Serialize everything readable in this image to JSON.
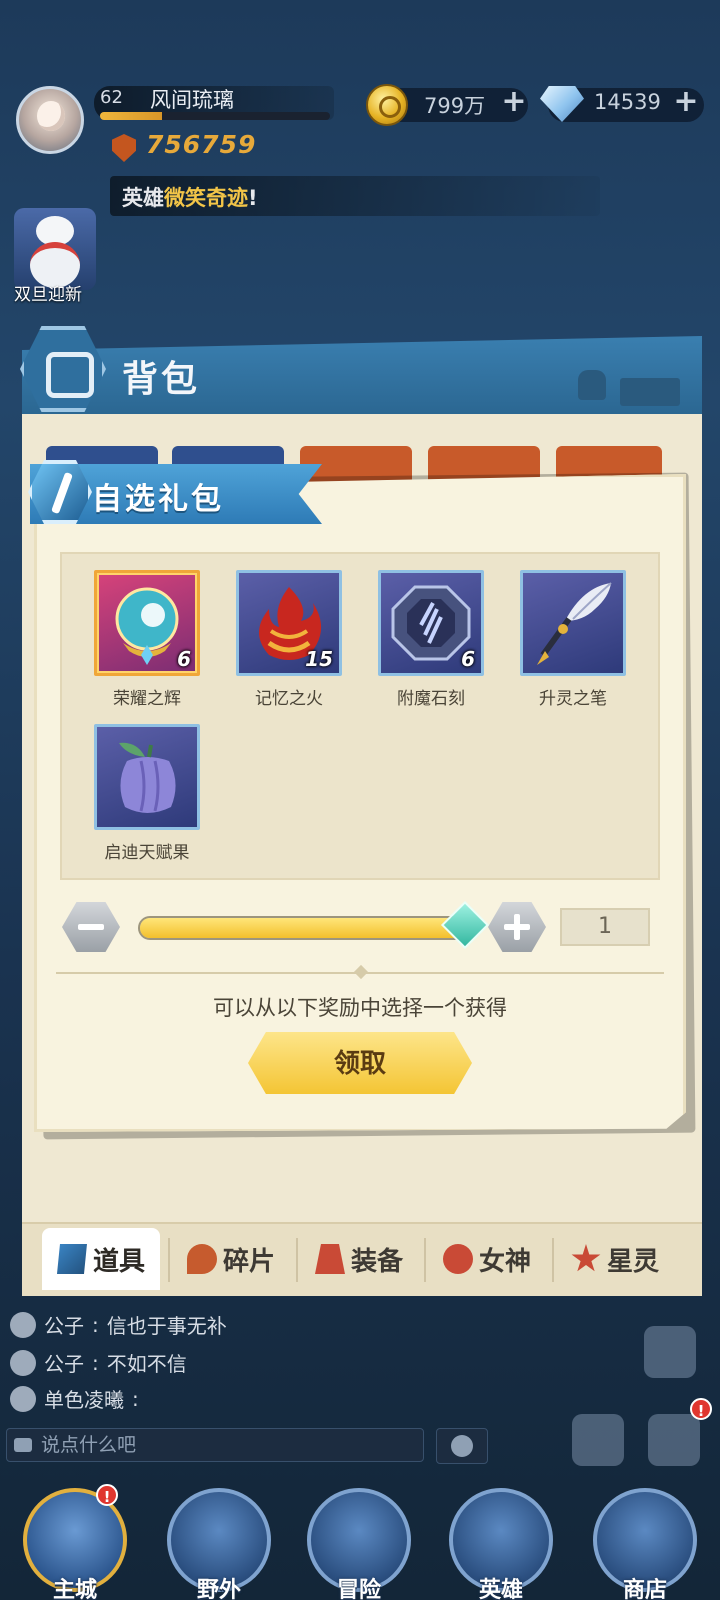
{
  "player": {
    "level": "62",
    "name": "风间琉璃",
    "exp_fraction": 0.27,
    "power": "756759"
  },
  "resources": {
    "gold": "799万",
    "diamonds": "14539"
  },
  "marquee": {
    "prefix": "英雄",
    "highlight": "微笑奇迹",
    "suffix": "!"
  },
  "event": {
    "label": "双旦迎新"
  },
  "backpack": {
    "title": "背包",
    "tabs": [
      {
        "label": "道具",
        "icon": "item-icon",
        "active": true
      },
      {
        "label": "碎片",
        "icon": "fragment-icon",
        "active": false
      },
      {
        "label": "装备",
        "icon": "equipment-icon",
        "active": false
      },
      {
        "label": "女神",
        "icon": "goddess-icon",
        "active": false
      },
      {
        "label": "星灵",
        "icon": "star-spirit-icon",
        "active": false
      }
    ]
  },
  "dialog": {
    "title": "自选礼包",
    "rewards": [
      {
        "name": "荣耀之辉",
        "count": "6",
        "icon": "glory-orb-icon",
        "rarity": "gold"
      },
      {
        "name": "记忆之火",
        "count": "15",
        "icon": "memory-fire-icon",
        "rarity": "blue"
      },
      {
        "name": "附魔石刻",
        "count": "6",
        "icon": "enchant-stone-icon",
        "rarity": "blue"
      },
      {
        "name": "升灵之笔",
        "count": "",
        "icon": "spirit-quill-icon",
        "rarity": "blue"
      },
      {
        "name": "启迪天赋果",
        "count": "",
        "icon": "talent-fruit-icon",
        "rarity": "blue"
      }
    ],
    "quantity": "1",
    "slider_fraction": 1.0,
    "hint": "可以从以下奖励中选择一个获得",
    "claim_label": "领取"
  },
  "chat": {
    "messages": [
      {
        "sender": "公子",
        "text": "信也于事无补"
      },
      {
        "sender": "公子",
        "text": "不如不信"
      },
      {
        "sender": "单色凌曦",
        "text": ""
      }
    ],
    "input_placeholder": "说点什么吧"
  },
  "nav": [
    {
      "label": "主城",
      "icon": "castle-icon",
      "badge": "!"
    },
    {
      "label": "野外",
      "icon": "wilderness-icon",
      "badge": ""
    },
    {
      "label": "冒险",
      "icon": "adventure-icon",
      "badge": ""
    },
    {
      "label": "英雄",
      "icon": "hero-helmet-icon",
      "badge": ""
    },
    {
      "label": "商店",
      "icon": "shop-icon",
      "badge": ""
    }
  ],
  "badges": {
    "side_bag": "!"
  },
  "colors": {
    "accent_blue": "#2e7bb6",
    "gold": "#f4c534",
    "parchment": "#f8f3df"
  }
}
